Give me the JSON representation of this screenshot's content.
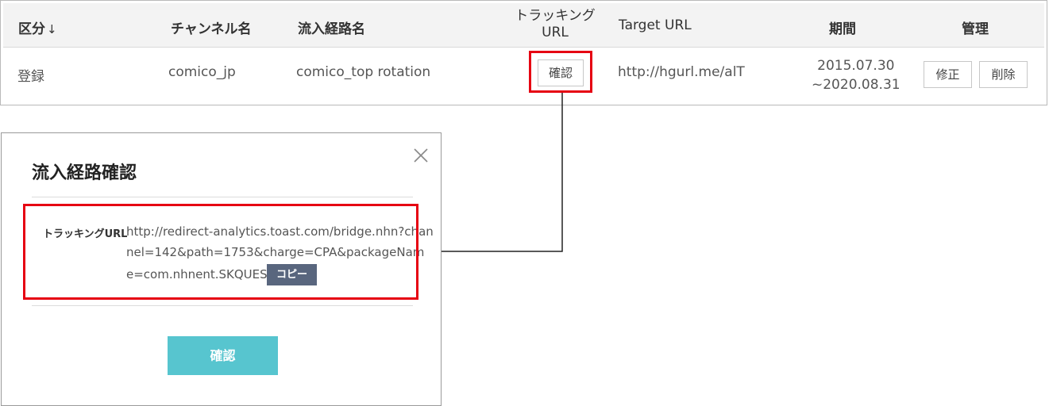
{
  "table": {
    "headers": {
      "category": "区分",
      "category_sort_icon": "↓",
      "channel": "チャンネル名",
      "route": "流入経路名",
      "tracking_line1": "トラッキング",
      "tracking_line2": "URL",
      "target": "Target URL",
      "period": "期間",
      "manage": "管理"
    },
    "row": {
      "category": "登録",
      "channel": "comico_jp",
      "route": "comico_top rotation",
      "tracking_button": "確認",
      "target_url": "http://hgurl.me/alT",
      "period_start": "2015.07.30",
      "period_end": "~2020.08.31",
      "edit_button": "修正",
      "delete_button": "削除"
    }
  },
  "modal": {
    "title": "流入経路確認",
    "close_icon": "close-icon",
    "field_label": "トラッキングURL",
    "url_line1": "http://redirect-analytics.toast.com/bridge.nhn?chan",
    "url_line2": "nel=142&path=1753&charge=CPA&packageNam",
    "url_line3": "e=com.nhnent.SKQUEST",
    "copy_button": "コピー",
    "confirm_button": "確認"
  },
  "colors": {
    "highlight": "#e60012",
    "confirm_button": "#57c5cf",
    "copy_button": "#59667e"
  }
}
